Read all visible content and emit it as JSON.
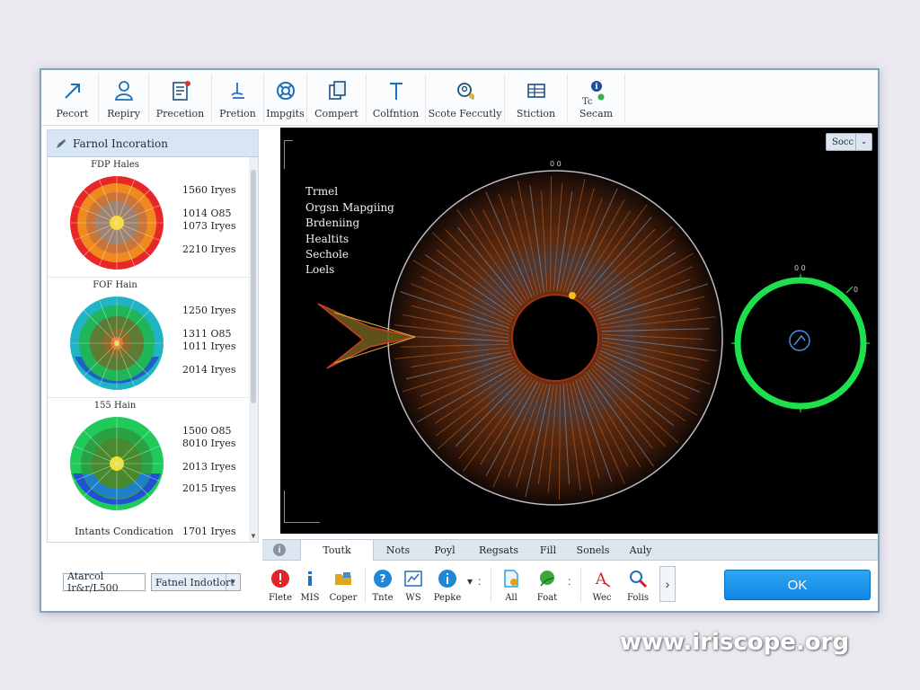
{
  "toolbar": {
    "items": [
      {
        "label": "Pecort",
        "icon": "arrow-icon"
      },
      {
        "label": "Repiry",
        "icon": "person-icon"
      },
      {
        "label": "Precetion",
        "icon": "document-icon"
      },
      {
        "label": "Pretion",
        "icon": "hand-icon"
      },
      {
        "label": "Impgits",
        "icon": "lifebuoy-icon"
      },
      {
        "label": "Compert",
        "icon": "copy-icon"
      },
      {
        "label": "Colfntion",
        "icon": "pin-icon"
      },
      {
        "label": "Scote Feccutly",
        "icon": "search-user-icon"
      },
      {
        "label": "Stiction",
        "icon": "table-icon"
      },
      {
        "label": "Secam",
        "icon": "info-icon",
        "badge": "Tc"
      }
    ]
  },
  "left_panel": {
    "title": "Farnol Incoration",
    "items": [
      {
        "title": "FDP Hales",
        "stats": [
          "1560 Iryes",
          "1014 O85",
          "1073 Iryes",
          "2210 Iryes"
        ],
        "palette": "red-orange"
      },
      {
        "title": "FOF Hain",
        "stats": [
          "1250 Iryes",
          "1311 O85",
          "1011 Iryes",
          "2014 Iryes"
        ],
        "palette": "teal-green"
      },
      {
        "title": "155 Hain",
        "stats": [
          "1500 O85",
          "8010 Iryes",
          "2013 Iryes",
          "2015 Iryes"
        ],
        "palette": "green-blue"
      }
    ],
    "footer_label": "Intants Condication",
    "footer_value": "1701 Iryes"
  },
  "bottom_left": {
    "dropdown1": "Atarcol Ir&r/L500",
    "dropdown2": "Fatnel Indotlort"
  },
  "viewer": {
    "sort_label": "Socc",
    "top_indicator": "0 0",
    "ring_top_label": "0 0",
    "ring_side_label": "0",
    "legend": [
      "Trmel",
      "Orgsn Mapgiing",
      "Brdeniing",
      "Healtits",
      "Sechole",
      "Loels"
    ]
  },
  "tabs": [
    "Toutk",
    "Nots",
    "Poyl",
    "Regsats",
    "Fill",
    "Sonels",
    "Auly"
  ],
  "bottom_tools": [
    {
      "label": "Flete",
      "icon": "alert-icon",
      "color": "#e0262b"
    },
    {
      "label": "MIS",
      "icon": "info-icon",
      "color": "#1f6fc1"
    },
    {
      "label": "Coper",
      "icon": "folder-icon",
      "color": "#e0a51f"
    },
    {
      "label": "Tnte",
      "icon": "help-icon",
      "color": "#1f88d6"
    },
    {
      "label": "WS",
      "icon": "chart-icon",
      "color": "#1f6fc1"
    },
    {
      "label": "Pepke",
      "icon": "info-circle-icon",
      "color": "#1f88d6"
    },
    {
      "label": "All",
      "icon": "file-icon",
      "color": "#2f9fe8"
    },
    {
      "label": "Foat",
      "icon": "leaf-icon",
      "color": "#3aa83a"
    },
    {
      "label": "Wec",
      "icon": "text-icon",
      "color": "#c9252b"
    },
    {
      "label": "Folis",
      "icon": "magnifier-icon",
      "color": "#c9252b"
    }
  ],
  "ok_label": "OK",
  "watermark": "www.iriscope.org"
}
